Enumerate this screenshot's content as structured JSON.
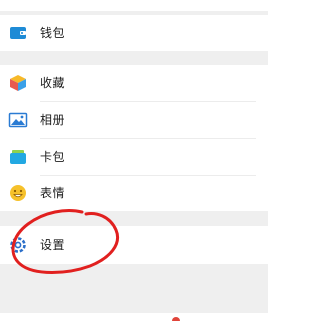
{
  "menu": {
    "wallet": {
      "label": "钱包",
      "icon": "wallet-icon"
    },
    "favorites": {
      "label": "收藏",
      "icon": "cube-icon"
    },
    "album": {
      "label": "相册",
      "icon": "image-icon"
    },
    "cards": {
      "label": "卡包",
      "icon": "card-pouch-icon"
    },
    "stickers": {
      "label": "表情",
      "icon": "smiley-icon"
    },
    "settings": {
      "label": "设置",
      "icon": "gear-icon"
    }
  },
  "annotation": {
    "color": "#e1201f",
    "target": "settings"
  },
  "colors": {
    "background": "#efefef",
    "row": "#ffffff",
    "text": "#1c1c1c",
    "wallet_icon": "#1e8bd6",
    "cards_icon": "#22a8e2",
    "smiley_icon": "#f6c12b",
    "gear_icon": "#2b6fc9"
  }
}
